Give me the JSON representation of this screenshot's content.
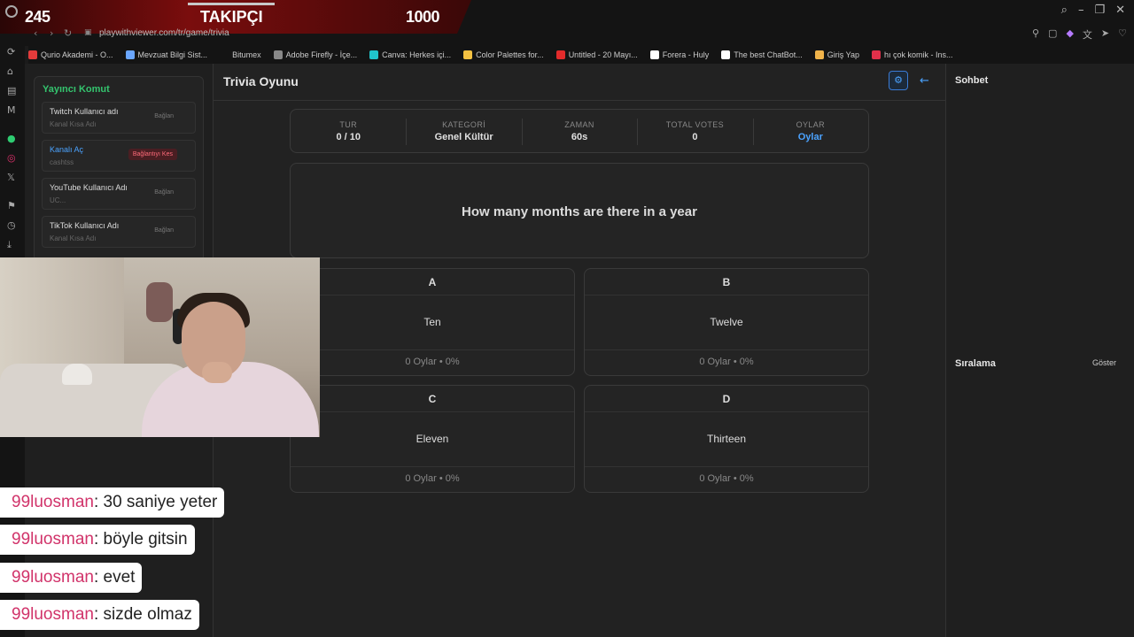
{
  "overlay": {
    "left_count": "245",
    "label": "TAKIPÇI",
    "right_count": "1000"
  },
  "browser": {
    "url": "playwithviewer.com/tr/game/trivia",
    "bookmarks": [
      {
        "label": "Qurio Akademi - O...",
        "color": "#e23b3b"
      },
      {
        "label": "Mevzuat Bilgi Sist...",
        "color": "#6aa6ff"
      },
      {
        "label": "Bitumex",
        "color": "#141414"
      },
      {
        "label": "Adobe Firefly - İçe...",
        "color": "#888888"
      },
      {
        "label": "Canva: Herkes içi...",
        "color": "#20c4cb"
      },
      {
        "label": "Color Palettes for...",
        "color": "#f5c242"
      },
      {
        "label": "Untitled - 20 Mayı...",
        "color": "#e22b2b"
      },
      {
        "label": "Forera - Huly",
        "color": "#ffffff"
      },
      {
        "label": "The best ChatBot...",
        "color": "#ffffff"
      },
      {
        "label": "Giriş Yap",
        "color": "#f0b34a"
      },
      {
        "label": "hı çok komik - Ins...",
        "color": "#e0304a"
      }
    ]
  },
  "left": {
    "title": "Yayıncı Komut",
    "accounts": [
      {
        "title": "Twitch Kullanıcı adı",
        "sub": "Kanal Kısa Adı",
        "action": "Bağlan"
      },
      {
        "title": "Kanalı Aç",
        "sub": "cashtss",
        "action": "Bağlantıyı Kes"
      },
      {
        "title": "YouTube Kullanıcı Adı",
        "sub": "UC...",
        "action": "Bağlan"
      },
      {
        "title": "TikTok Kullanıcı Adı",
        "sub": "Kanal Kısa Adı",
        "action": "Bağlan"
      }
    ]
  },
  "main": {
    "title": "Trivia Oyunu",
    "stats": [
      {
        "key": "TUR",
        "value": "0 / 10"
      },
      {
        "key": "KATEGORİ",
        "value": "Genel Kültür"
      },
      {
        "key": "ZAMAN",
        "value": "60s"
      },
      {
        "key": "TOTAL VOTES",
        "value": "0"
      },
      {
        "key": "OYLAR",
        "value": "Oylar"
      }
    ],
    "question": "How many months are there in a year",
    "options": [
      {
        "letter": "A",
        "answer": "Ten",
        "votes": "0 Oylar • 0%"
      },
      {
        "letter": "B",
        "answer": "Twelve",
        "votes": "0 Oylar • 0%"
      },
      {
        "letter": "C",
        "answer": "Eleven",
        "votes": "0 Oylar • 0%"
      },
      {
        "letter": "D",
        "answer": "Thirteen",
        "votes": "0 Oylar • 0%"
      }
    ]
  },
  "right": {
    "chat_title": "Sohbet",
    "rank_title": "Sıralama",
    "show_label": "Göster"
  },
  "chat": [
    {
      "user": "99luosman",
      "text": " : 30 saniye yeter"
    },
    {
      "user": "99luosman",
      "text": " : böyle gitsin"
    },
    {
      "user": "99luosman",
      "text": " : evet"
    },
    {
      "user": "99luosman",
      "text": " : sizde olmaz"
    }
  ]
}
